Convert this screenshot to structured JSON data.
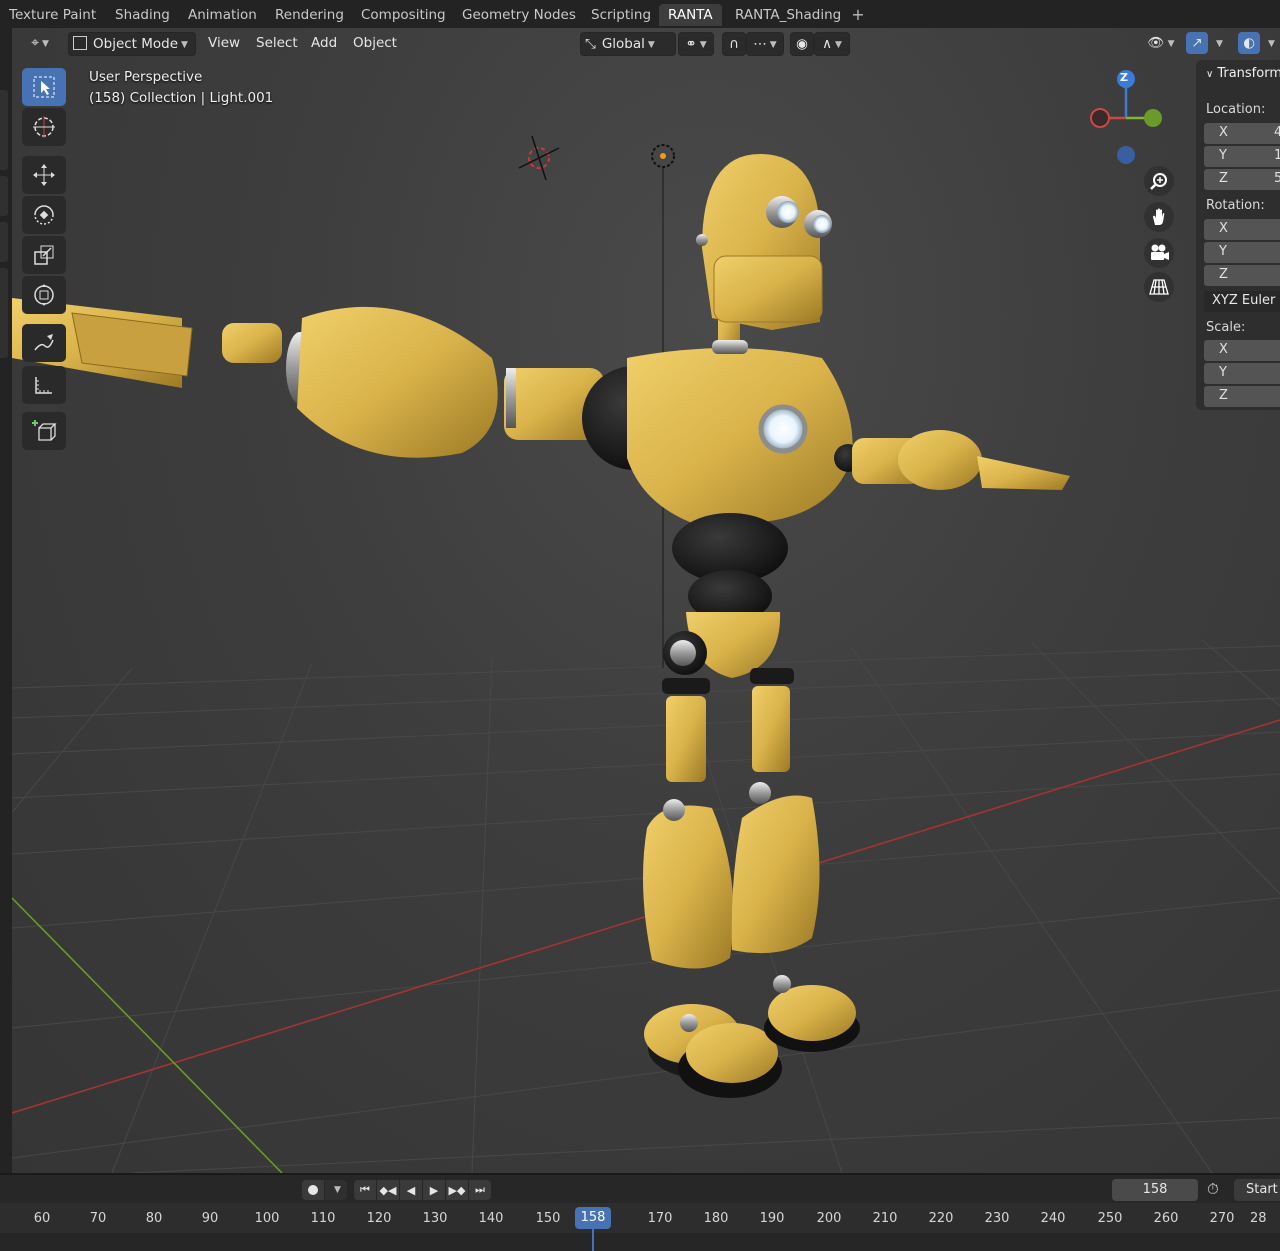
{
  "workspace_tabs": [
    "Texture Paint",
    "Shading",
    "Animation",
    "Rendering",
    "Compositing",
    "Geometry Nodes",
    "Scripting",
    "RANTA",
    "RANTA_Shading"
  ],
  "active_tab": "RANTA",
  "header": {
    "mode": "Object Mode",
    "menus": [
      "View",
      "Select",
      "Add",
      "Object"
    ],
    "transform_orientation": "Global"
  },
  "viewport": {
    "view_name": "User Perspective",
    "context": "(158) Collection | Light.001"
  },
  "gizmo_axes": {
    "x": "X",
    "y": "Y",
    "z": "Z"
  },
  "n_panel": {
    "section": "Transform",
    "location_label": "Location:",
    "rotation_label": "Rotation:",
    "scale_label": "Scale:",
    "axis_x": "X",
    "axis_y": "Y",
    "axis_z": "Z",
    "loc_x_partial": "4",
    "loc_y_partial": "1",
    "loc_z_partial": "5",
    "rotation_mode": "XYZ Euler"
  },
  "timeline": {
    "current_frame": "158",
    "start_label": "Start",
    "ruler": [
      "60",
      "70",
      "80",
      "90",
      "100",
      "110",
      "120",
      "130",
      "140",
      "150",
      "158",
      "170",
      "180",
      "190",
      "200",
      "210",
      "220",
      "230",
      "240",
      "250",
      "260",
      "270",
      "28"
    ]
  },
  "colors": {
    "robot_yellow": "#d9b24a",
    "active_blue": "#4772b3",
    "axis_red": "#b33a3a",
    "axis_green": "#6a9a2a"
  }
}
